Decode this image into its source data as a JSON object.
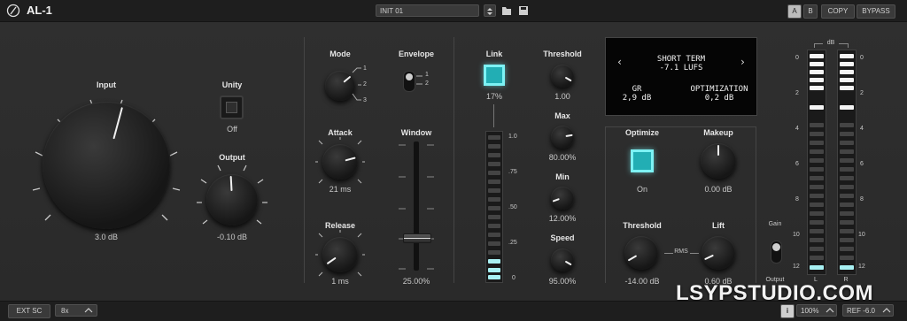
{
  "header": {
    "logo_icon": "feather-circle-icon",
    "title": "AL-1",
    "preset_name": "INIT 01",
    "ab_a": "A",
    "ab_b": "B",
    "copy_label": "COPY",
    "bypass_label": "BYPASS"
  },
  "input": {
    "label": "Input",
    "value": "3.0 dB"
  },
  "unity": {
    "label": "Unity",
    "state": "Off"
  },
  "output": {
    "label": "Output",
    "value": "-0.10 dB"
  },
  "mode": {
    "label": "Mode",
    "options": [
      "1",
      "2",
      "3"
    ]
  },
  "envelope": {
    "label": "Envelope",
    "options": [
      "1",
      "2"
    ]
  },
  "attack": {
    "label": "Attack",
    "value": "21 ms"
  },
  "window": {
    "label": "Window",
    "value": "25.00%"
  },
  "release": {
    "label": "Release",
    "value": "1 ms"
  },
  "link": {
    "label": "Link",
    "value": "17%",
    "scale": [
      "1.0",
      ".75",
      ".50",
      ".25",
      "0"
    ]
  },
  "threshold_left": {
    "label": "Threshold",
    "value": "1.00"
  },
  "max": {
    "label": "Max",
    "value": "80.00%"
  },
  "min": {
    "label": "Min",
    "value": "12.00%"
  },
  "speed": {
    "label": "Speed",
    "value": "95.00%"
  },
  "display": {
    "mode": "SHORT TERM",
    "loudness": "-7.1 LUFS",
    "gr_label": "GR",
    "gr_value": "2,9 dB",
    "opt_label": "OPTIMIZATION",
    "opt_value": "0,2 dB"
  },
  "optimize": {
    "label": "Optimize",
    "state": "On"
  },
  "makeup": {
    "label": "Makeup",
    "value": "0.00 dB"
  },
  "threshold_right": {
    "label": "Threshold",
    "value": "-14.00 dB"
  },
  "rms": {
    "label": "RMS"
  },
  "lift": {
    "label": "Lift",
    "value": "0.60 dB"
  },
  "gain_output": {
    "top": "Gain",
    "bottom": "Output"
  },
  "meter": {
    "unit": "dB",
    "scale": [
      "0",
      "2",
      "4",
      "6",
      "8",
      "10",
      "12"
    ],
    "left_label": "L",
    "right_label": "R"
  },
  "footer": {
    "ext_sc": "EXT SC",
    "oversample": "8x",
    "info": "i",
    "zoom": "100%",
    "ref": "REF -6.0"
  },
  "watermark": "LSYPSTUDIO.COM"
}
